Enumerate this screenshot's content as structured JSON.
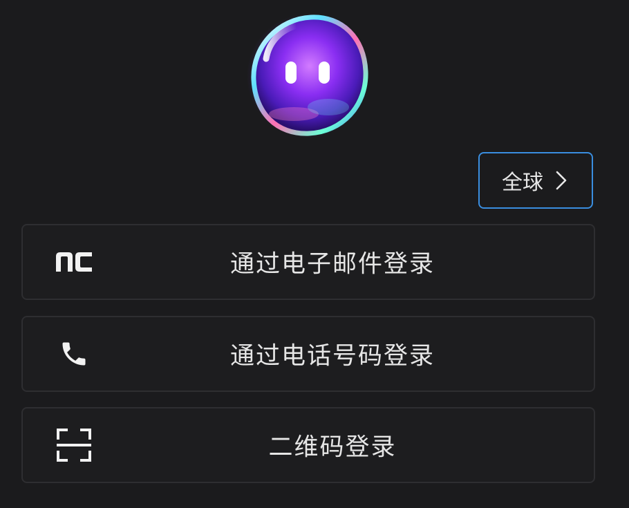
{
  "region": {
    "label": "全球",
    "icon": "chevron-right-icon",
    "border_color": "#3a8ee0"
  },
  "logo": {
    "icon": "bubble-mascot-icon",
    "colors": [
      "#7b2ff7",
      "#c04cff",
      "#3ad6ff",
      "#ff5fa2",
      "#5cf2c4"
    ]
  },
  "login_options": [
    {
      "label": "通过电子邮件登录",
      "icon": "nc-logo-icon"
    },
    {
      "label": "通过电话号码登录",
      "icon": "phone-icon"
    },
    {
      "label": "二维码登录",
      "icon": "qr-scan-icon"
    }
  ],
  "theme": {
    "background": "#1b1b1d",
    "option_border": "#2e2e31",
    "text": "#e6e6e6"
  }
}
